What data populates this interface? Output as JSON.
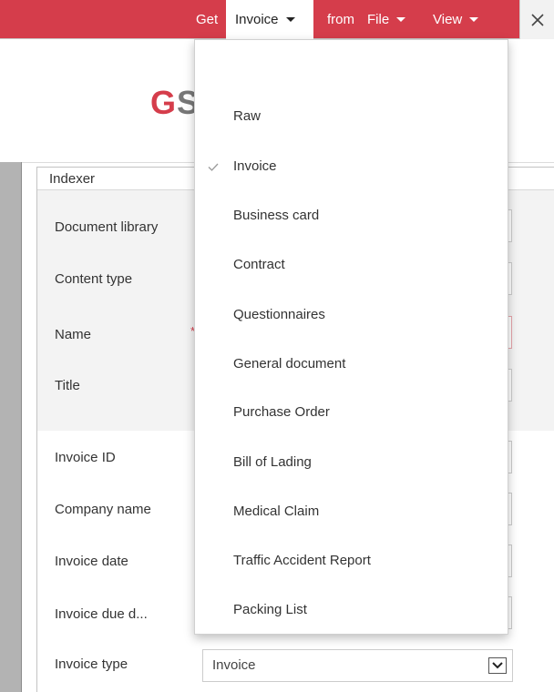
{
  "topbar": {
    "get_label": "Get",
    "document_type_selected": "Invoice",
    "from_label": "from",
    "source_label": "File",
    "view_label": "View",
    "accent_color": "#d53d4b"
  },
  "logo": {
    "text_part1": "G",
    "text_part2": "S"
  },
  "panel": {
    "title": "Indexer",
    "fields": [
      {
        "label": "Document library"
      },
      {
        "label": "Content type"
      },
      {
        "label": "Name",
        "required": true
      },
      {
        "label": "Title"
      },
      {
        "label": "Invoice ID"
      },
      {
        "label": "Company name"
      },
      {
        "label": "Invoice date"
      },
      {
        "label": "Invoice due d..."
      },
      {
        "label": "Invoice type",
        "value": "Invoice"
      }
    ]
  },
  "dropdown": {
    "selected": "Invoice",
    "items": [
      {
        "label": "Raw"
      },
      {
        "label": "Invoice",
        "checked": true
      },
      {
        "label": "Business card"
      },
      {
        "label": "Contract"
      },
      {
        "label": "Questionnaires"
      },
      {
        "label": "General document"
      },
      {
        "label": "Purchase Order"
      },
      {
        "label": "Bill of Lading"
      },
      {
        "label": "Medical Claim"
      },
      {
        "label": "Traffic Accident Report"
      },
      {
        "label": "Packing List"
      }
    ]
  }
}
